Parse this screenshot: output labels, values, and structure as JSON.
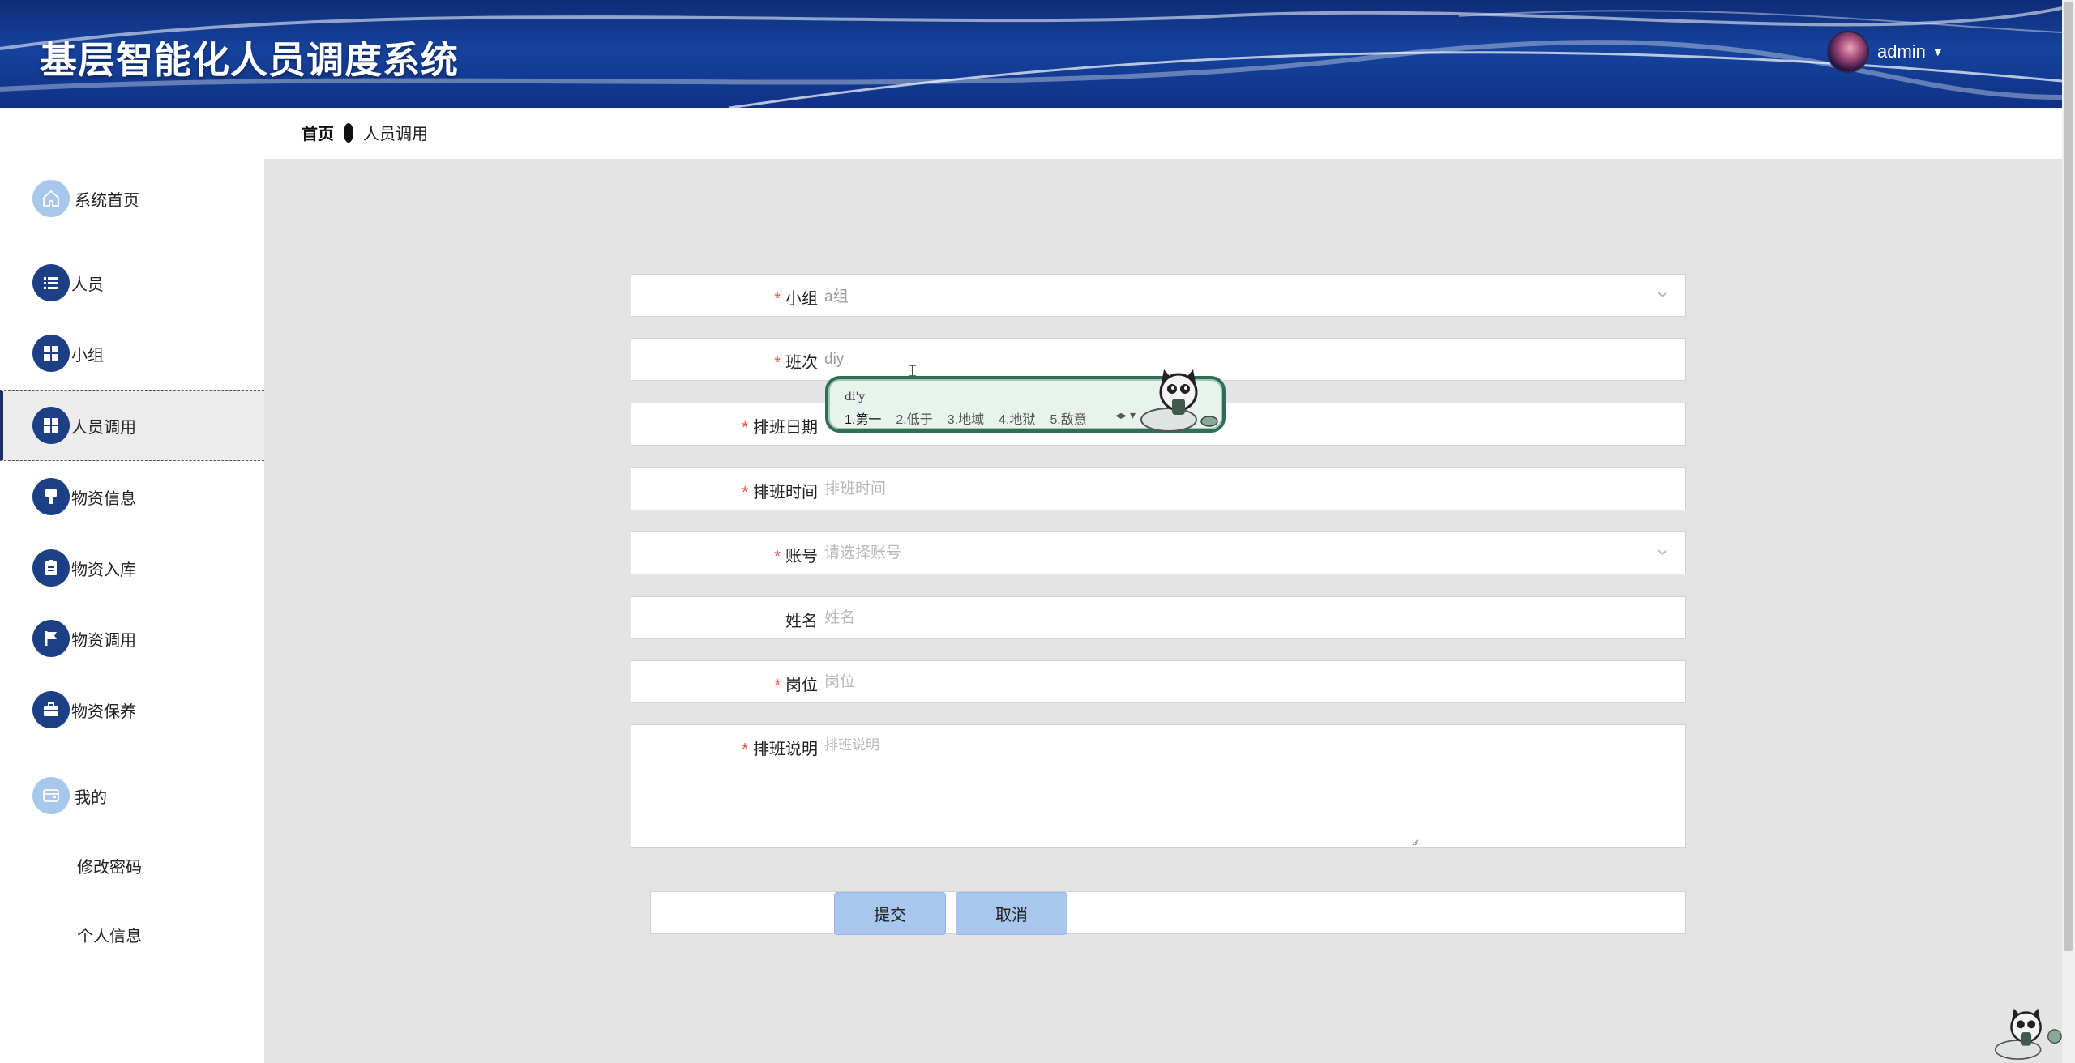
{
  "header": {
    "title": "基层智能化人员调度系统",
    "user": {
      "name": "admin"
    }
  },
  "breadcrumb": {
    "home": "首页",
    "current": "人员调用"
  },
  "sidebar": {
    "items": [
      {
        "label": "系统首页",
        "icon": "home-icon"
      },
      {
        "label": "人员",
        "icon": "list-icon"
      },
      {
        "label": "小组",
        "icon": "grid-icon"
      },
      {
        "label": "人员调用",
        "icon": "grid-icon",
        "active": true
      },
      {
        "label": "物资信息",
        "icon": "brush-icon"
      },
      {
        "label": "物资入库",
        "icon": "clipboard-icon"
      },
      {
        "label": "物资调用",
        "icon": "flag-icon"
      },
      {
        "label": "物资保养",
        "icon": "briefcase-icon"
      },
      {
        "label": "我的",
        "icon": "wallet-icon"
      }
    ],
    "sub_items": [
      {
        "label": "修改密码"
      },
      {
        "label": "个人信息"
      }
    ]
  },
  "form": {
    "group": {
      "label": "小组",
      "value": "a组",
      "required": true
    },
    "shift": {
      "label": "班次",
      "value": "diy",
      "required": true
    },
    "date": {
      "label": "排班日期",
      "placeholder": "",
      "required": true
    },
    "time": {
      "label": "排班时间",
      "placeholder": "排班时间",
      "required": true
    },
    "account": {
      "label": "账号",
      "placeholder": "请选择账号",
      "required": true
    },
    "name": {
      "label": "姓名",
      "placeholder": "姓名",
      "required": false
    },
    "position": {
      "label": "岗位",
      "placeholder": "岗位",
      "required": true
    },
    "notes": {
      "label": "排班说明",
      "placeholder": "排班说明",
      "required": true
    },
    "submit_label": "提交",
    "cancel_label": "取消",
    "required_mark": "*"
  },
  "ime": {
    "composition": "di'y",
    "candidates": [
      "1.第一",
      "2.低于",
      "3.地域",
      "4.地狱",
      "5.敌意"
    ]
  },
  "colors": {
    "header_bg": "#16439d",
    "nav_icon_bg": "#1d3f86",
    "button_bg": "#a9c6ee",
    "required": "#e74c3c"
  }
}
